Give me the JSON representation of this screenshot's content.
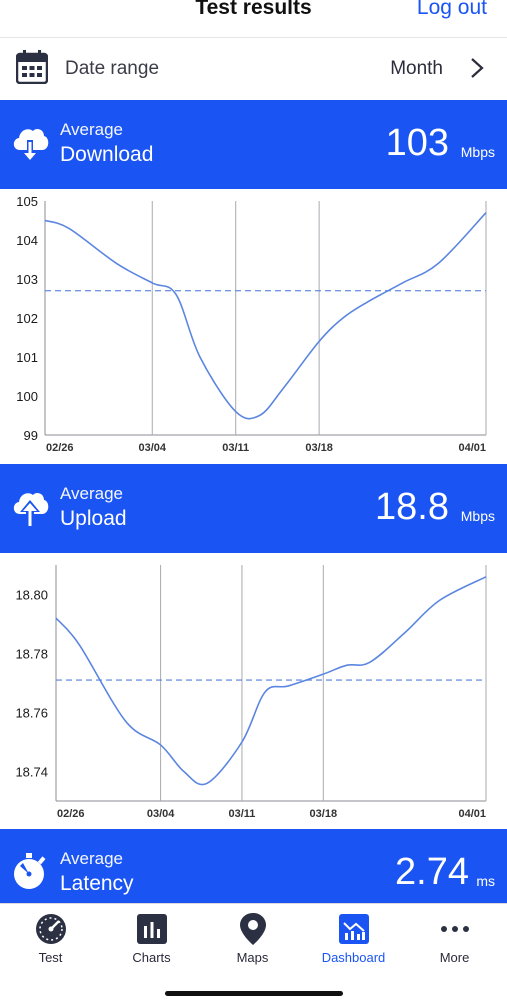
{
  "header": {
    "title": "Test results",
    "logout_label": "Log out"
  },
  "date_range": {
    "label": "Date range",
    "value": "Month"
  },
  "download": {
    "avg_label": "Average",
    "metric_label": "Download",
    "value": "103",
    "unit": "Mbps",
    "icon": "cloud-download-icon"
  },
  "upload": {
    "avg_label": "Average",
    "metric_label": "Upload",
    "value": "18.8",
    "unit": "Mbps",
    "icon": "cloud-upload-icon"
  },
  "latency": {
    "avg_label": "Average",
    "metric_label": "Latency",
    "value": "2.74",
    "unit": "ms",
    "icon": "stopwatch-icon"
  },
  "tabs": [
    {
      "label": "Test",
      "icon": "speedometer-icon",
      "active": false
    },
    {
      "label": "Charts",
      "icon": "bar-chart-icon",
      "active": false
    },
    {
      "label": "Maps",
      "icon": "map-pin-icon",
      "active": false
    },
    {
      "label": "Dashboard",
      "icon": "dashboard-icon",
      "active": true
    },
    {
      "label": "More",
      "icon": "more-dots-icon",
      "active": false
    }
  ],
  "colors": {
    "accent": "#1a55f3",
    "line": "#5b86e0",
    "grid": "#a9a9b0"
  },
  "chart_data": [
    {
      "type": "line",
      "x": [
        "02/26",
        "02/28",
        "03/01",
        "03/04",
        "03/06",
        "03/08",
        "03/11",
        "03/13",
        "03/15",
        "03/18",
        "03/20",
        "03/22",
        "03/25",
        "03/28",
        "04/01"
      ],
      "series": [
        {
          "values": [
            104.5,
            104.3,
            103.4,
            102.9,
            102.6,
            101.0,
            99.6,
            99.5,
            100.2,
            101.4,
            102.0,
            102.4,
            102.9,
            103.4,
            104.7
          ]
        }
      ],
      "average": 102.7,
      "x_ticks": [
        "02/26",
        "03/04",
        "03/11",
        "03/18",
        "04/01"
      ],
      "y_ticks": [
        "99",
        "100",
        "101",
        "102",
        "103",
        "104",
        "105"
      ],
      "ylim": [
        99,
        105
      ],
      "grid": "vertical"
    },
    {
      "type": "line",
      "x": [
        "02/26",
        "02/28",
        "03/01",
        "03/04",
        "03/06",
        "03/08",
        "03/11",
        "03/13",
        "03/15",
        "03/18",
        "03/20",
        "03/22",
        "03/25",
        "03/28",
        "04/01"
      ],
      "series": [
        {
          "values": [
            18.792,
            18.783,
            18.757,
            18.749,
            18.74,
            18.736,
            18.75,
            18.767,
            18.769,
            18.773,
            18.776,
            18.777,
            18.787,
            18.798,
            18.806
          ]
        }
      ],
      "average": 18.771,
      "x_ticks": [
        "02/26",
        "03/04",
        "03/11",
        "03/18",
        "04/01"
      ],
      "y_ticks": [
        "18.74",
        "18.76",
        "18.78",
        "18.80"
      ],
      "ylim": [
        18.73,
        18.81
      ],
      "grid": "vertical"
    }
  ]
}
